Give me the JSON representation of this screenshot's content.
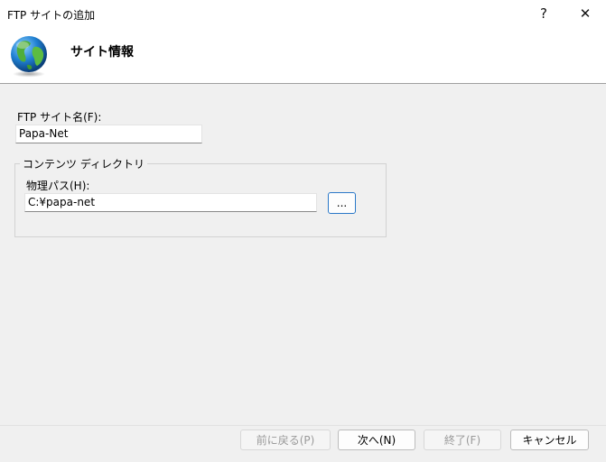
{
  "window": {
    "title": "FTP サイトの追加",
    "help_label": "?",
    "close_label": "✕"
  },
  "header": {
    "section_title": "サイト情報",
    "icon": "globe-icon"
  },
  "form": {
    "site_name_label": "FTP サイト名(F):",
    "site_name_value": "Papa-Net",
    "content_group_label": "コンテンツ ディレクトリ",
    "physical_path_label": "物理パス(H):",
    "physical_path_value": "C:¥papa-net",
    "browse_label": "..."
  },
  "footer": {
    "back_label": "前に戻る(P)",
    "next_label": "次へ(N)",
    "finish_label": "終了(F)",
    "cancel_label": "キャンセル"
  }
}
